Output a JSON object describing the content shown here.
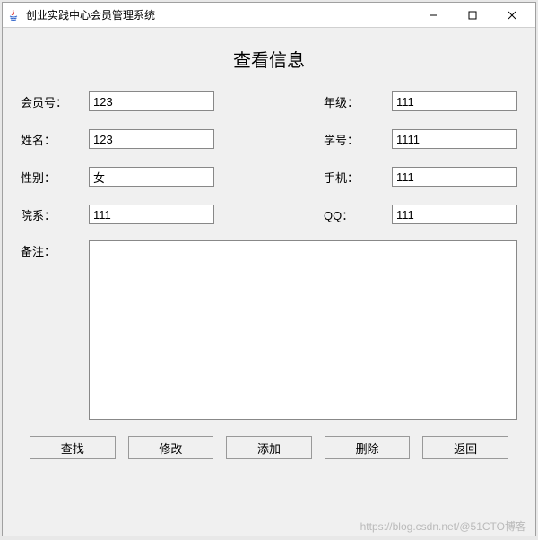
{
  "window": {
    "title": "创业实践中心会员管理系统"
  },
  "page_title": "查看信息",
  "fields": {
    "member_id": {
      "label": "会员号：",
      "value": "123"
    },
    "grade": {
      "label": "年级：",
      "value": "111"
    },
    "name": {
      "label": "姓名：",
      "value": "123"
    },
    "student_no": {
      "label": "学号：",
      "value": "1111"
    },
    "gender": {
      "label": "性别：",
      "value": "女"
    },
    "phone": {
      "label": "手机：",
      "value": "111"
    },
    "department": {
      "label": "院系：",
      "value": "111"
    },
    "qq": {
      "label": "QQ：",
      "value": "111"
    },
    "remark": {
      "label": "备注：",
      "value": ""
    }
  },
  "buttons": {
    "search": "查找",
    "modify": "修改",
    "add": "添加",
    "delete": "删除",
    "back": "返回"
  },
  "watermark": "https://blog.csdn.net/@51CTO博客"
}
